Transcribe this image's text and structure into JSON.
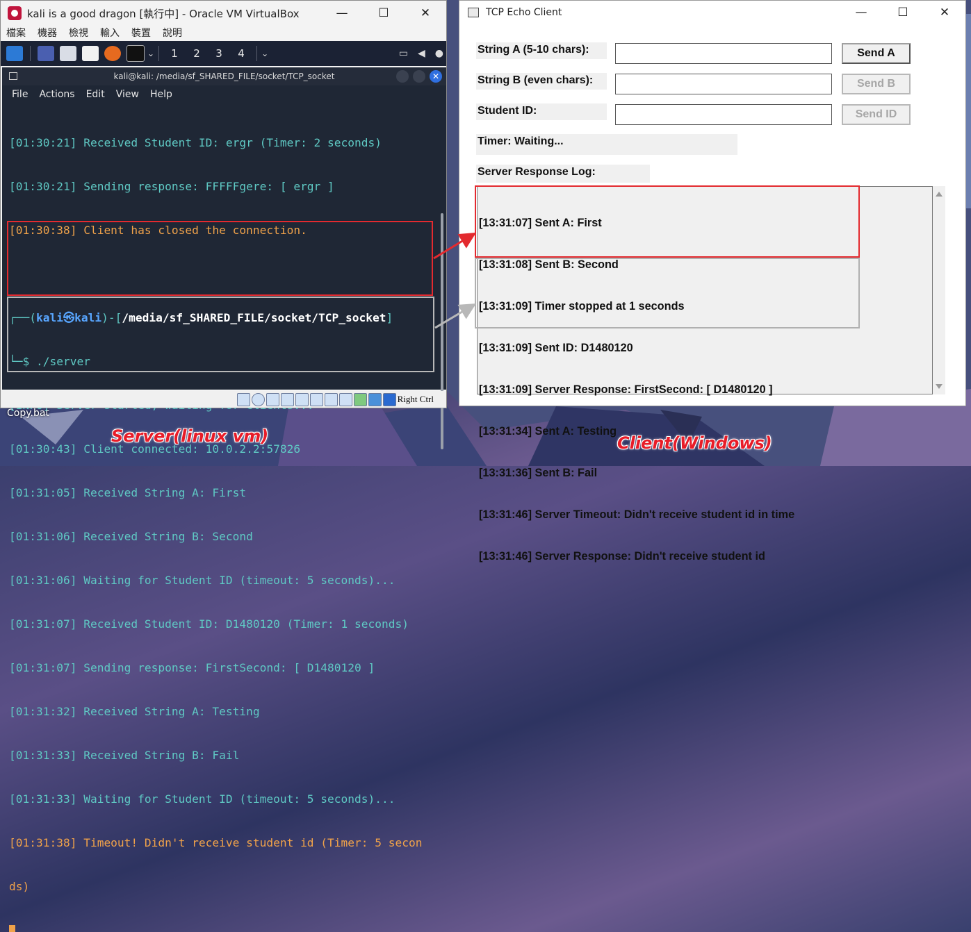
{
  "vbox": {
    "title": "kali is a good dragon [執行中] - Oracle VM VirtualBox",
    "menu": [
      "檔案",
      "機器",
      "檢視",
      "輸入",
      "裝置",
      "說明"
    ],
    "workspaces": [
      "1",
      "2",
      "3",
      "4"
    ],
    "status_right_ctrl": "Right Ctrl"
  },
  "terminal": {
    "title": "kali@kali: /media/sf_SHARED_FILE/socket/TCP_socket",
    "menu": [
      "File",
      "Actions",
      "Edit",
      "View",
      "Help"
    ],
    "lines": [
      {
        "text": "[01:30:21] Received Student ID: ergr (Timer: 2 seconds)",
        "color": "teal"
      },
      {
        "text": "[01:30:21] Sending response: FFFFFgere: [ ergr ]",
        "color": "teal"
      },
      {
        "text": "[01:30:38] Client has closed the connection.",
        "color": "orange"
      },
      {
        "text": "",
        "color": "teal"
      }
    ],
    "prompt_line1_a": "┌──(",
    "prompt_user": "kali㉿kali",
    "prompt_line1_b": ")-[",
    "prompt_path": "/media/sf_SHARED_FILE/socket/TCP_socket",
    "prompt_line1_c": "]",
    "prompt_line2": "└─$ ./server",
    "lines2": [
      {
        "text": "[INFO] Server started, waiting for clients...",
        "color": "teal"
      },
      {
        "text": "[01:30:43] Client connected: 10.0.2.2:57826",
        "color": "teal"
      },
      {
        "text": "[01:31:05] Received String A: First",
        "color": "teal"
      },
      {
        "text": "[01:31:06] Received String B: Second",
        "color": "teal"
      },
      {
        "text": "[01:31:06] Waiting for Student ID (timeout: 5 seconds)...",
        "color": "teal"
      },
      {
        "text": "[01:31:07] Received Student ID: D1480120 (Timer: 1 seconds)",
        "color": "teal"
      },
      {
        "text": "[01:31:07] Sending response: FirstSecond: [ D1480120 ]",
        "color": "teal"
      },
      {
        "text": "[01:31:32] Received String A: Testing",
        "color": "teal"
      },
      {
        "text": "[01:31:33] Received String B: Fail",
        "color": "teal"
      },
      {
        "text": "[01:31:33] Waiting for Student ID (timeout: 5 seconds)...",
        "color": "teal"
      },
      {
        "text": "[01:31:38] Timeout! Didn't receive student id (Timer: 5 secon",
        "color": "orange"
      },
      {
        "text": "ds)",
        "color": "orange"
      }
    ]
  },
  "desktop": {
    "file_label": "Copy.bat",
    "caption_server": "Server(linux vm)",
    "caption_client": "Client(Windows)"
  },
  "client": {
    "title": "TCP Echo Client",
    "label_a": "String A (5-10 chars):",
    "label_b": "String B (even chars):",
    "label_id": "Student ID:",
    "btn_a": "Send A",
    "btn_b": "Send B",
    "btn_id": "Send ID",
    "timer": "Timer: Waiting...",
    "log_label": "Server Response Log:",
    "log": [
      "[13:31:07] Sent A: First",
      "[13:31:08] Sent B: Second",
      "[13:31:09] Timer stopped at 1 seconds",
      "[13:31:09] Sent ID: D1480120",
      "[13:31:09] Server Response: FirstSecond: [ D1480120 ]",
      "[13:31:34] Sent A: Testing",
      "[13:31:36] Sent B: Fail",
      "[13:31:46] Server Timeout: Didn't receive student id in time",
      "[13:31:46] Server Response: Didn't receive student id"
    ]
  },
  "colors": {
    "highlight_red": "#e32a2f",
    "highlight_gray": "#b8b8b8",
    "term_teal": "#5fc9c4",
    "term_orange": "#f0a24a"
  }
}
